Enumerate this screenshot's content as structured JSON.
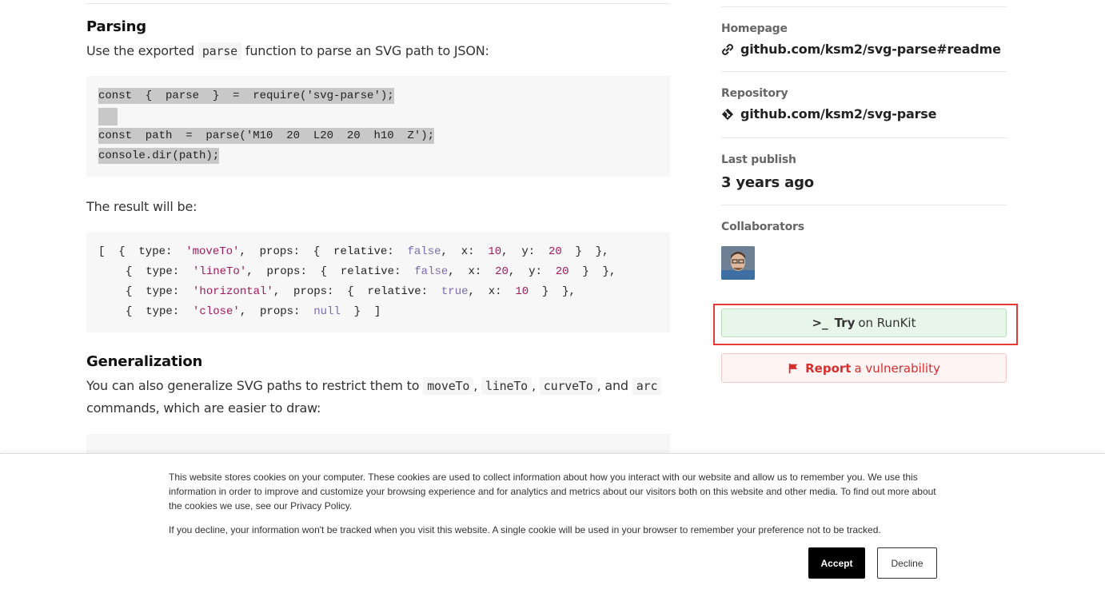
{
  "readme": {
    "parsing": {
      "heading": "Parsing",
      "text_before": "Use the exported",
      "code": "parse",
      "text_after": "function to parse an SVG path to JSON:",
      "code_lines": [
        "const  {  parse  }  =  require('svg-parse');",
        "const  path  =  parse('M10  20  L20  20  h10  Z');",
        "console.dir(path);"
      ]
    },
    "result": {
      "text": "The result will be:",
      "lines": {
        "l1": {
          "open": "[  {  type:  ",
          "type": "'moveTo'",
          "mid": ",  props:  {  relative:  ",
          "rel": "false",
          "x_label": ",  x:  ",
          "x": "10",
          "y_label": ",  y:  ",
          "y": "20",
          "close": "  }  },"
        },
        "l2": {
          "open": "{  type:  ",
          "type": "'lineTo'",
          "mid": ",  props:  {  relative:  ",
          "rel": "false",
          "x_label": ",  x:  ",
          "x": "20",
          "y_label": ",  y:  ",
          "y": "20",
          "close": "  }  },"
        },
        "l3": {
          "open": "{  type:  ",
          "type": "'horizontal'",
          "mid": ",  props:  {  relative:  ",
          "rel": "true",
          "x_label": ",  x:  ",
          "x": "10",
          "close": "  }  },"
        },
        "l4": {
          "open": "{  type:  ",
          "type": "'close'",
          "mid": ",  props:  ",
          "val": "null",
          "close": "  }  ]"
        }
      }
    },
    "generalization": {
      "heading": "Generalization",
      "text_1": "You can also generalize SVG paths to restrict them to",
      "codes": [
        "moveTo",
        "lineTo",
        "curveTo",
        "arc"
      ],
      "sep_1": ",",
      "sep_2": ",",
      "sep_3": ", and",
      "text_2": "commands, which are easier to draw:"
    }
  },
  "sidebar": {
    "homepage": {
      "label": "Homepage",
      "value": "github.com/ksm2/svg-parse#readme"
    },
    "repository": {
      "label": "Repository",
      "value": "github.com/ksm2/svg-parse"
    },
    "last_publish": {
      "label": "Last publish",
      "value": "3 years ago"
    },
    "collaborators": {
      "label": "Collaborators"
    },
    "runkit": {
      "prompt": ">_",
      "strong": "Try",
      "rest": "on RunKit"
    },
    "report": {
      "strong": "Report",
      "rest": "a vulnerability"
    }
  },
  "cookie_banner": {
    "paragraph_1": "This website stores cookies on your computer. These cookies are used to collect information about how you interact with our website and allow us to remember you. We use this information in order to improve and customize your browsing experience and for analytics and metrics about our visitors both on this website and other media. To find out more about the cookies we use, see our Privacy Policy.",
    "paragraph_2": "If you decline, your information won't be tracked when you visit this website. A single cookie will be used in your browser to remember your preference not to be tracked.",
    "accept_label": "Accept",
    "decline_label": "Decline"
  },
  "colors": {
    "string": "#a11a5c",
    "keyword": "#7a6cae",
    "runkit_bg": "#e8f6e9",
    "report_text": "#d32f2f",
    "highlight_border": "#e53935"
  }
}
